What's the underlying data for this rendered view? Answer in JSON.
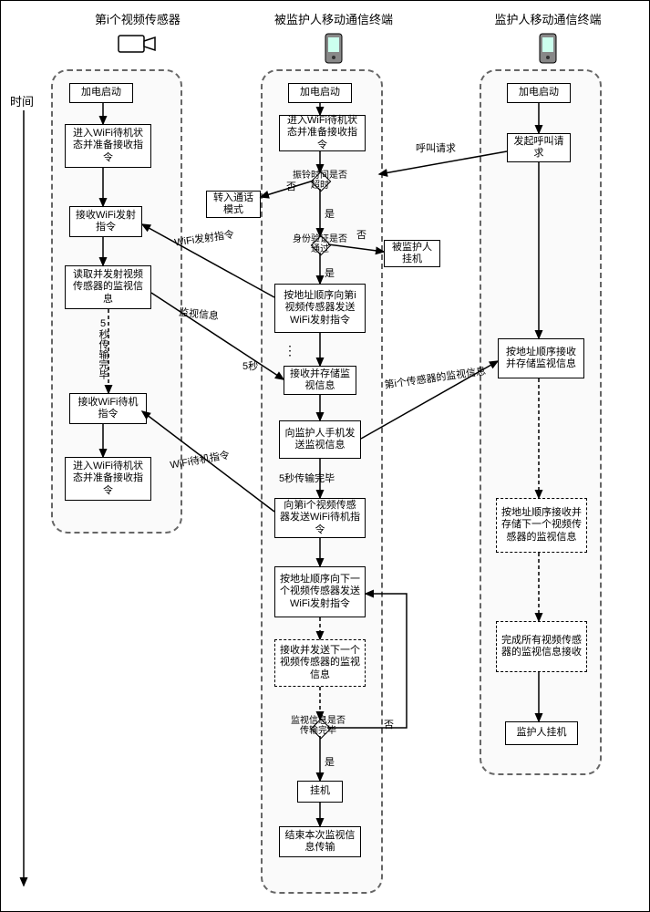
{
  "time_axis": "时间",
  "headers": {
    "sensor": "第i个视频传感器",
    "ward": "被监护人移动通信终端",
    "guardian": "监护人移动通信终端"
  },
  "a": {
    "start": "加电启动",
    "standby1": "进入WiFi待机状态并准备接收指令",
    "recv_emit": "接收WiFi发射指令",
    "read_emit": "读取并发射视频传感器的监视信息",
    "five_sec_done": "5秒传输完毕",
    "recv_standby": "接收WiFi待机指令",
    "standby2": "进入WiFi待机状态并准备接收指令"
  },
  "b": {
    "start": "加电启动",
    "wifi_standby": "进入WiFi待机状态并准备接收指令",
    "ring_timeout": "振铃时间是否超时",
    "to_call_mode": "转入通话模式",
    "identity_check": "身份验证是否通过",
    "ward_hangup": "被监护人挂机",
    "send_emit_cmd": "按地址顺序向第i视频传感器发送WiFi发射指令",
    "recv_store": "接收并存储监视信息",
    "send_to_guardian": "向监护人手机发送监视信息",
    "five_sec_note": "5秒传输完毕",
    "send_standby_cmd": "向第i个视频传感器发送WiFi待机指令",
    "next_emit_cmd": "按地址顺序向下一个视频传感器发送WiFi发射指令",
    "recv_send_next": "接收并发送下一个视频传感器的监视信息",
    "all_done_check": "监视信息是否传输完毕",
    "hangup": "挂机",
    "end": "结束本次监视信息传输"
  },
  "c": {
    "start": "加电启动",
    "call": "发起呼叫请求",
    "recv_store": "按地址顺序接收并存储监视信息",
    "recv_next": "按地址顺序接收并存储下一个视频传感器的监视信息",
    "all_done": "完成所有视频传感器的监视信息接收",
    "hangup": "监护人挂机"
  },
  "edge": {
    "call_req": "呼叫请求",
    "wifi_emit_cmd": "WiFi发射指令",
    "monitor_info": "监视信息",
    "wifi_standby_cmd": "WiFi待机指令",
    "sensor_i_info": "第i个传感器的监视信息",
    "yes": "是",
    "no": "否",
    "five_sec": "5秒"
  }
}
